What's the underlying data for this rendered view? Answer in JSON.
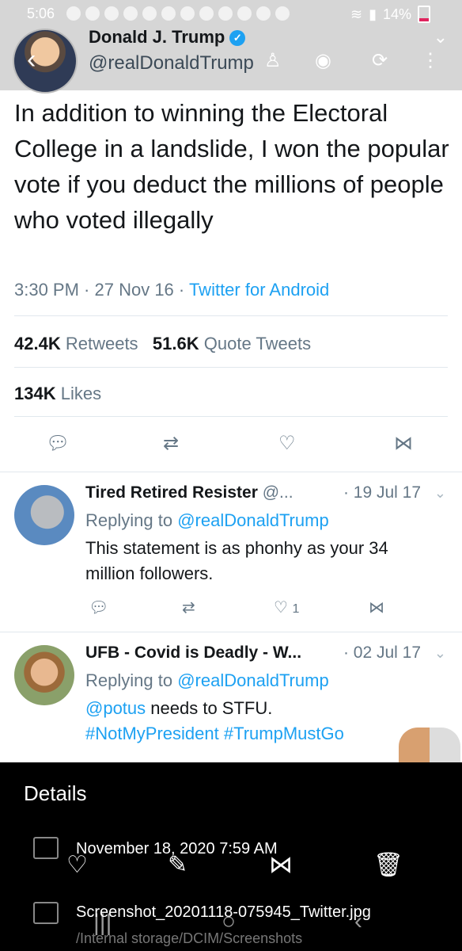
{
  "status_bar": {
    "time": "5:06",
    "battery": "14%",
    "notification_icons": [
      "app-icon",
      "facebook-icon",
      "facebook-icon",
      "youtube-icon",
      "w-icon",
      "oo-icon",
      "burst-icon",
      "facebook-icon",
      "shield-icon",
      "mail-icon",
      "cnn-icon",
      "cnn-icon"
    ]
  },
  "header": {
    "name": "Donald J. Trump",
    "handle": "@realDonaldTrump"
  },
  "tweet": {
    "text": "In addition to winning the Electoral College in a landslide, I won the popular vote if you deduct the millions of people who voted illegally",
    "time": "3:30 PM",
    "date": "27 Nov 16",
    "source": "Twitter for Android",
    "retweets_count": "42.4K",
    "retweets_label": "Retweets",
    "quotes_count": "51.6K",
    "quotes_label": "Quote Tweets",
    "likes_count": "134K",
    "likes_label": "Likes"
  },
  "replies": [
    {
      "name": "Tired Retired Resister",
      "handle": "@...",
      "date": "19 Jul 17",
      "replying_label": "Replying to",
      "replying_to": "@realDonaldTrump",
      "body": "This statement is as phonhy as your 34 million followers.",
      "likes": "1"
    },
    {
      "name": "UFB - Covid is Deadly - W...",
      "date": "02 Jul 17",
      "replying_label": "Replying to",
      "replying_to": "@realDonaldTrump",
      "mention": "@potus",
      "body_rest": "needs to STFU.",
      "hashtag1": "#NotMyPresident",
      "hashtag2": "#TrumpMustGo"
    }
  ],
  "details": {
    "title": "Details",
    "datetime": "November 18, 2020 7:59 AM",
    "filename": "Screenshot_20201118-075945_Twitter.jpg",
    "path": "/Internal storage/DCIM/Screenshots"
  }
}
